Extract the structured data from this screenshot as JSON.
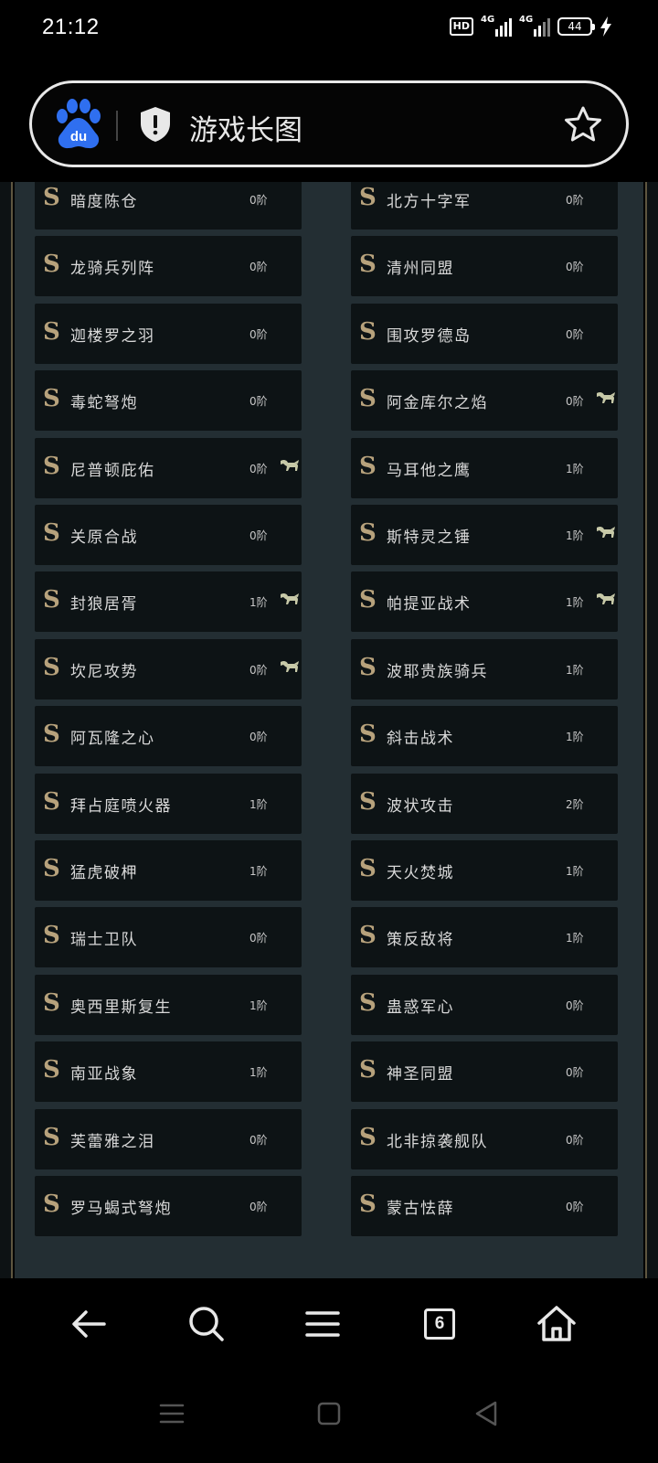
{
  "status_bar": {
    "time": "21:12",
    "hd_label": "HD",
    "signal1_label": "4G",
    "signal2_label": "4G",
    "battery": "44"
  },
  "search_bar": {
    "title": "游戏长图"
  },
  "items": [
    [
      {
        "name": "暗度陈仓",
        "rank": "0阶",
        "horse": false
      },
      {
        "name": "北方十字军",
        "rank": "0阶",
        "horse": false
      }
    ],
    [
      {
        "name": "龙骑兵列阵",
        "rank": "0阶",
        "horse": false
      },
      {
        "name": "清州同盟",
        "rank": "0阶",
        "horse": false
      }
    ],
    [
      {
        "name": "迦楼罗之羽",
        "rank": "0阶",
        "horse": false
      },
      {
        "name": "围攻罗德岛",
        "rank": "0阶",
        "horse": false
      }
    ],
    [
      {
        "name": "毒蛇弩炮",
        "rank": "0阶",
        "horse": false
      },
      {
        "name": "阿金库尔之焰",
        "rank": "0阶",
        "horse": true
      }
    ],
    [
      {
        "name": "尼普顿庇佑",
        "rank": "0阶",
        "horse": true
      },
      {
        "name": "马耳他之鹰",
        "rank": "1阶",
        "horse": false
      }
    ],
    [
      {
        "name": "关原合战",
        "rank": "0阶",
        "horse": false
      },
      {
        "name": "斯特灵之锤",
        "rank": "1阶",
        "horse": true
      }
    ],
    [
      {
        "name": "封狼居胥",
        "rank": "1阶",
        "horse": true
      },
      {
        "name": "帕提亚战术",
        "rank": "1阶",
        "horse": true
      }
    ],
    [
      {
        "name": "坎尼攻势",
        "rank": "0阶",
        "horse": true
      },
      {
        "name": "波耶贵族骑兵",
        "rank": "1阶",
        "horse": false
      }
    ],
    [
      {
        "name": "阿瓦隆之心",
        "rank": "0阶",
        "horse": false
      },
      {
        "name": "斜击战术",
        "rank": "1阶",
        "horse": false
      }
    ],
    [
      {
        "name": "拜占庭喷火器",
        "rank": "1阶",
        "horse": false
      },
      {
        "name": "波状攻击",
        "rank": "2阶",
        "horse": false
      }
    ],
    [
      {
        "name": "猛虎破柙",
        "rank": "1阶",
        "horse": false
      },
      {
        "name": "天火焚城",
        "rank": "1阶",
        "horse": false
      }
    ],
    [
      {
        "name": "瑞士卫队",
        "rank": "0阶",
        "horse": false
      },
      {
        "name": "策反敌将",
        "rank": "1阶",
        "horse": false
      }
    ],
    [
      {
        "name": "奥西里斯复生",
        "rank": "1阶",
        "horse": false
      },
      {
        "name": "蛊惑军心",
        "rank": "0阶",
        "horse": false
      }
    ],
    [
      {
        "name": "南亚战象",
        "rank": "1阶",
        "horse": false
      },
      {
        "name": "神圣同盟",
        "rank": "0阶",
        "horse": false
      }
    ],
    [
      {
        "name": "芙蕾雅之泪",
        "rank": "0阶",
        "horse": false
      },
      {
        "name": "北非掠袭舰队",
        "rank": "0阶",
        "horse": false
      }
    ],
    [
      {
        "name": "罗马蝎式弩炮",
        "rank": "0阶",
        "horse": false
      },
      {
        "name": "蒙古怯薛",
        "rank": "0阶",
        "horse": false
      }
    ]
  ],
  "s_letter": "S",
  "bottom_nav": {
    "tab_count": "6"
  },
  "colors": {
    "panel_bg": "#232e33",
    "card_bg": "#0d1315",
    "s_gold": "#b7a27c",
    "baidu_blue": "#2f6ff0"
  }
}
